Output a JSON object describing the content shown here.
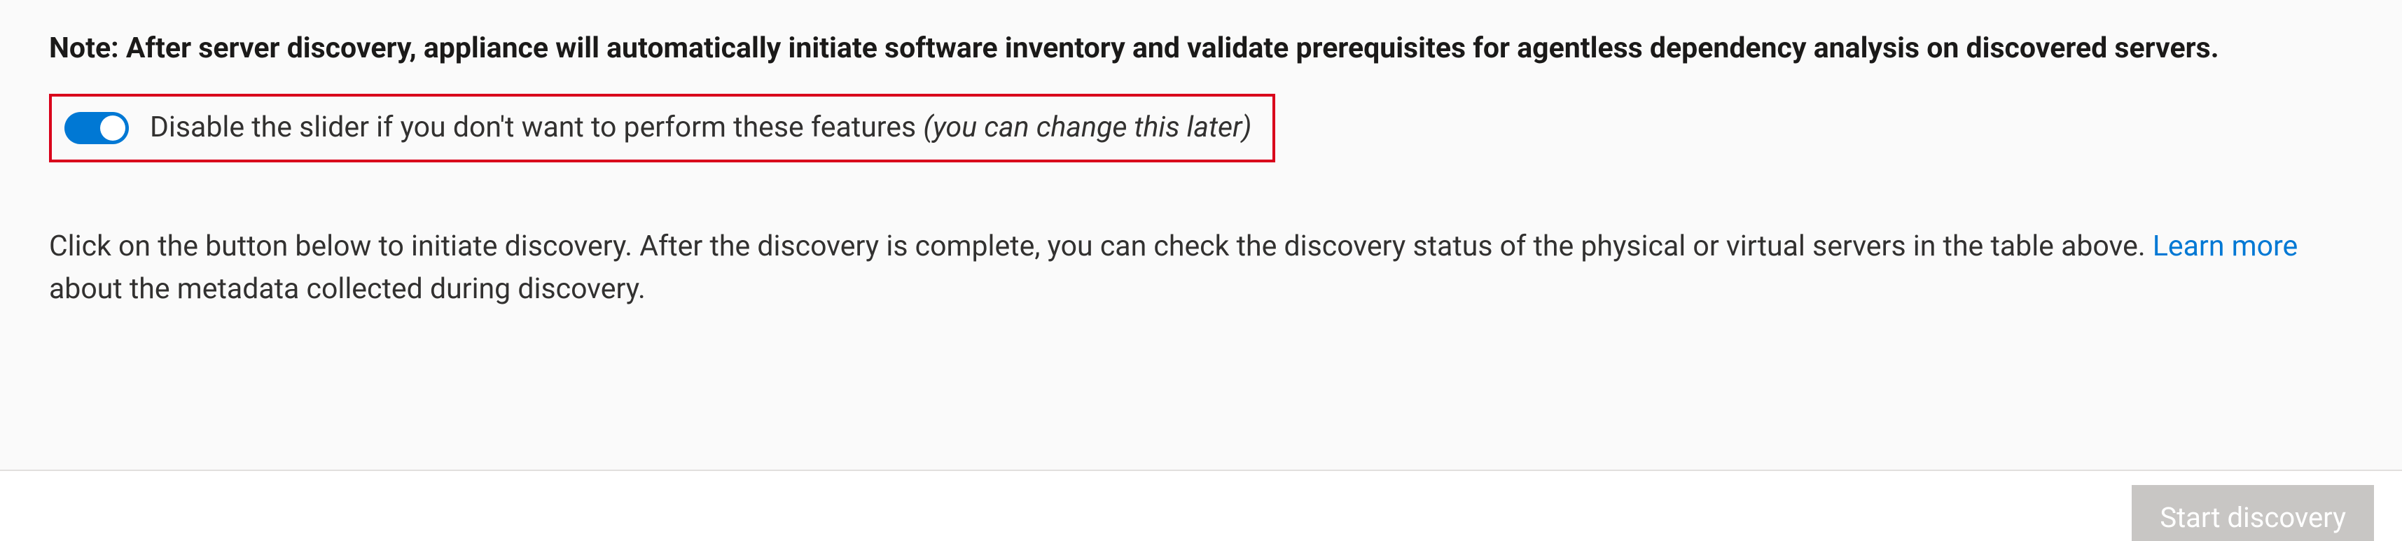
{
  "note": "Note: After server discovery, appliance will automatically initiate software inventory and validate prerequisites for agentless dependency analysis on discovered servers.",
  "toggle": {
    "label_main": "Disable the slider if you don't want to perform these features ",
    "label_hint": "(you can change this later)",
    "state": "on"
  },
  "description": {
    "part1": "Click on the button below to initiate discovery. After the discovery is complete, you can check the discovery status of the physical or virtual servers in the table above. ",
    "link": "Learn more",
    "part2": " about the metadata collected during discovery."
  },
  "button": {
    "start_discovery": "Start discovery"
  }
}
